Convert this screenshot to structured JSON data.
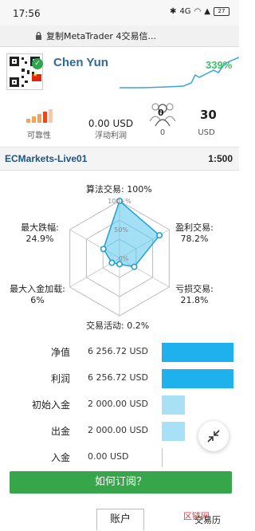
{
  "status_bar": {
    "time": "17:56",
    "network": "4G",
    "battery": "27"
  },
  "browser": {
    "page_title": "复制MetaTrader 4交易信..."
  },
  "profile": {
    "name": "Chen Yun",
    "growth": "339%"
  },
  "stats": {
    "reliability_label": "可靠性",
    "floating_value": "0.00 USD",
    "floating_label": "浮动利润",
    "subscribers_badge": "0",
    "subscribers_label": "0",
    "price_value": "30",
    "price_unit": "USD"
  },
  "account": {
    "name": "ECMarkets-Live01",
    "leverage": "1:500"
  },
  "radar": {
    "algo_label": "算法交易: 100%",
    "profit_label": "盈利交易:",
    "profit_value": "78.2%",
    "loss_label": "亏损交易:",
    "loss_value": "21.8%",
    "activity_label": "交易活动: 0.2%",
    "max_deposit_label": "最大入金加载:",
    "max_deposit_value": "6%",
    "max_drawdown_label": "最大跌幅:",
    "max_drawdown_value": "24.9%",
    "ring_100": "100+%",
    "ring_50": "50%",
    "ring_0": "0%",
    "values": {
      "algo": 100,
      "profit": 78.2,
      "loss": 21.8,
      "activity": 0.2,
      "max_deposit": 6,
      "max_drawdown": 24.9
    }
  },
  "financials": [
    {
      "label": "净值",
      "value": "6 256.72 USD",
      "fill": 1.0,
      "tone": "dark"
    },
    {
      "label": "利润",
      "value": "6 256.72 USD",
      "fill": 1.0,
      "tone": "dark"
    },
    {
      "label": "初始入金",
      "value": "2 000.00 USD",
      "fill": 0.32,
      "tone": "light"
    },
    {
      "label": "出金",
      "value": "2 000.00 USD",
      "fill": 0.32,
      "tone": "light"
    },
    {
      "label": "入金",
      "value": "0.00 USD",
      "fill": 0.0,
      "tone": "light"
    }
  ],
  "subscribe_button": "如何订阅？",
  "tabs": {
    "account": "账户",
    "history": "交易历"
  },
  "watermark": "区链网",
  "colors": {
    "accent": "#2f6a96",
    "growth": "#3bbf68",
    "bar": "#1fb0ee",
    "bar_light": "#a8e0f6",
    "button": "#37a64b",
    "radar_fill": "#58c7ee"
  }
}
